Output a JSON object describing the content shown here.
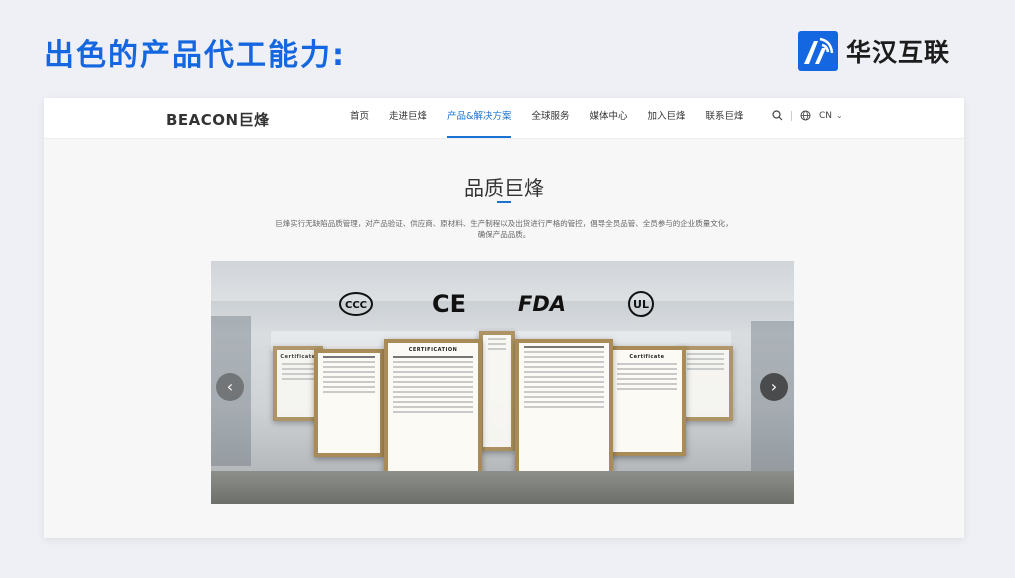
{
  "slide": {
    "title": "出色的产品代工能力:"
  },
  "brand": {
    "name": "华汉互联"
  },
  "site": {
    "logo_text": "BEACON",
    "logo_cn": "巨烽",
    "nav": [
      "首页",
      "走进巨烽",
      "产品&解决方案",
      "全球服务",
      "媒体中心",
      "加入巨烽",
      "联系巨烽"
    ],
    "active_nav": "产品&解决方案",
    "lang": "CN"
  },
  "section": {
    "title": "品质巨烽",
    "desc_line1": "巨烽实行无缺陷品质管理，对产品验证、供应商、原材料、生产制程以及出货进行严格的管控，倡导全员品管、全员参与的企业质量文化，",
    "desc_line2": "确保产品品质。"
  },
  "carousel": {
    "cert_marks": [
      "CCC",
      "CE",
      "FDA",
      "UL"
    ],
    "cert_headings": [
      "Certificate",
      "CERTIFICATION",
      "Certificate"
    ],
    "prev_label": "‹",
    "next_label": "›"
  }
}
